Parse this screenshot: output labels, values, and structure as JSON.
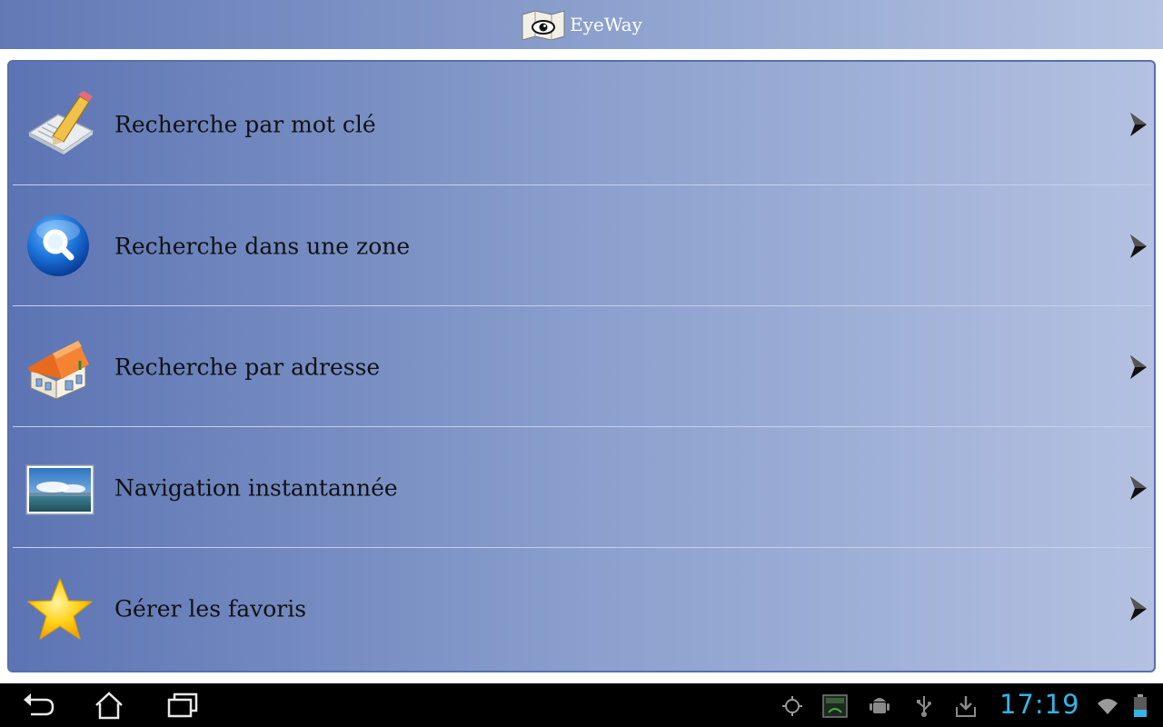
{
  "app": {
    "title": "EyeWay"
  },
  "menu": [
    {
      "label": "Recherche par mot clé",
      "icon": "edit-note-icon"
    },
    {
      "label": "Recherche dans une zone",
      "icon": "magnifier-globe-icon"
    },
    {
      "label": "Recherche par adresse",
      "icon": "house-icon"
    },
    {
      "label": "Navigation instantannée",
      "icon": "landscape-picture-icon"
    },
    {
      "label": "Gérer les favoris",
      "icon": "star-icon"
    }
  ],
  "system_bar": {
    "clock": "17:19"
  },
  "colors": {
    "accent": "#33b5e5",
    "header": "#6279b6",
    "panel_border": "#5670ad"
  }
}
